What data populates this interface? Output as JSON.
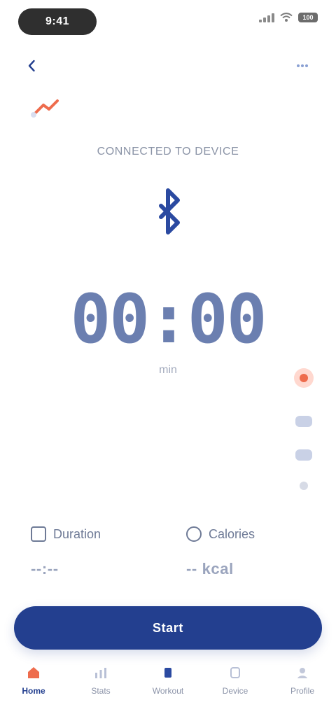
{
  "status": {
    "time": "9:41",
    "battery": "100"
  },
  "session": {
    "label": "CONNECTED TO DEVICE"
  },
  "timer": {
    "display": "00:00",
    "sub": "min"
  },
  "stats": [
    {
      "title": "Duration",
      "value": "--:--"
    },
    {
      "title": "Calories",
      "value": "-- kcal"
    }
  ],
  "primary_button": {
    "label": "Start"
  },
  "nav": [
    {
      "label": "Home"
    },
    {
      "label": "Stats"
    },
    {
      "label": "Workout"
    },
    {
      "label": "Device"
    },
    {
      "label": "Profile"
    }
  ],
  "colors": {
    "accent": "#233f8f",
    "timer": "#6b7fb0",
    "alert": "#ee6c4d",
    "muted": "#8b93a8"
  },
  "icons": {
    "back": "back-arrow-icon",
    "more": "more-icon",
    "bluetooth": "bluetooth-icon",
    "badge": "badge-icon",
    "stat_duration": "clock-icon",
    "stat_calories": "flame-icon"
  }
}
